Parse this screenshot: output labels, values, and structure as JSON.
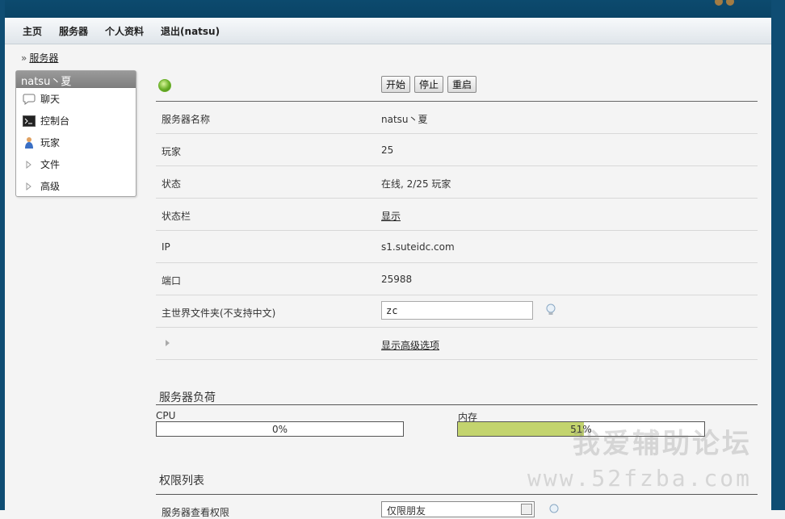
{
  "nav": {
    "items": [
      "主页",
      "服务器",
      "个人资料",
      "退出(natsu)"
    ]
  },
  "breadcrumb": {
    "separator": "»",
    "link": "服务器"
  },
  "sidebar": {
    "title": "natsu丶夏",
    "items": [
      {
        "label": "聊天",
        "icon": "chat-icon"
      },
      {
        "label": "控制台",
        "icon": "console-icon"
      },
      {
        "label": "玩家",
        "icon": "player-icon"
      },
      {
        "label": "文件",
        "icon": "expand-arrow-icon"
      },
      {
        "label": "高级",
        "icon": "expand-arrow-icon"
      }
    ]
  },
  "controls": {
    "start": "开始",
    "stop": "停止",
    "restart": "重启",
    "status_color": "#6cb12a"
  },
  "info": {
    "rows": [
      {
        "key": "服务器名称",
        "value": "natsu丶夏"
      },
      {
        "key": "玩家",
        "value": "25"
      },
      {
        "key": "状态",
        "value": "在线, 2/25 玩家"
      },
      {
        "key": "状态栏",
        "value": "显示"
      },
      {
        "key": "IP",
        "value": "s1.suteidc.com"
      },
      {
        "key": "端口",
        "value": "25988"
      },
      {
        "key": "主世界文件夹(不支持中文)",
        "value": "zc"
      }
    ],
    "advanced_link": "显示高级选项"
  },
  "load": {
    "title": "服务器负荷",
    "cpu_label": "CPU",
    "cpu_value": "0%",
    "cpu_fraction": 0.0,
    "mem_label": "内存",
    "mem_value": "51%",
    "mem_fraction": 0.51,
    "fill_color": "#c3d46e"
  },
  "permissions": {
    "title": "权限列表",
    "row_label": "服务器查看权限",
    "select_value": "仅限朋友"
  },
  "watermark": {
    "line1": "我爱辅助论坛",
    "line2": "www.52fzba.com"
  }
}
